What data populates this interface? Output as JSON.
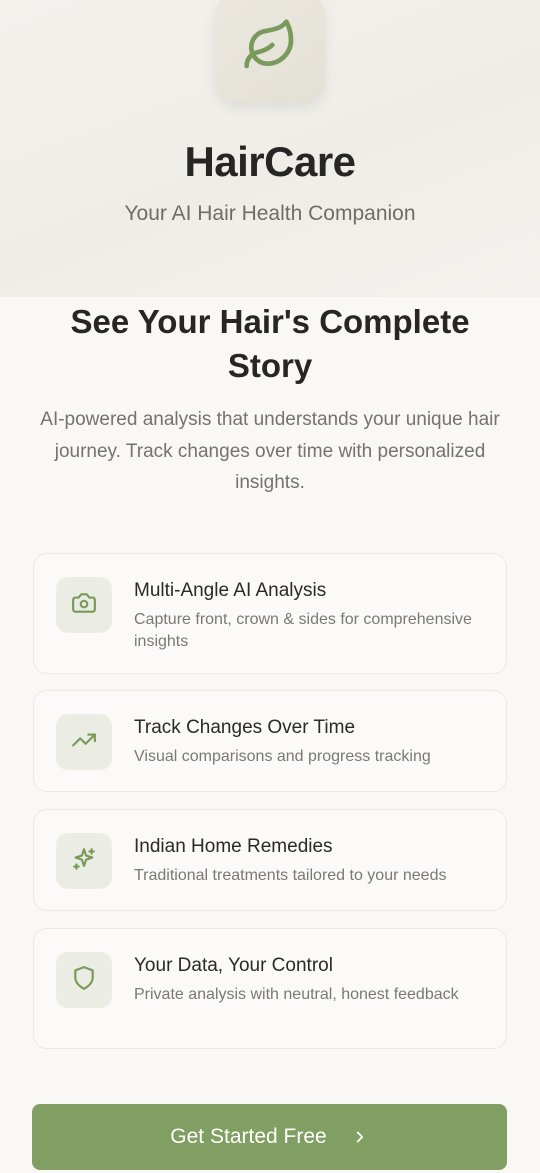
{
  "app": {
    "title": "HairCare",
    "subtitle": "Your AI Hair Health Companion",
    "logo_icon": "leaf-icon"
  },
  "intro": {
    "headline": "See Your Hair's Complete Story",
    "description": "AI-powered analysis that understands your unique hair journey. Track changes over time with personalized insights."
  },
  "features": [
    {
      "icon": "camera-icon",
      "title": "Multi-Angle AI Analysis",
      "description": "Capture front, crown & sides for comprehensive insights"
    },
    {
      "icon": "trending-up-icon",
      "title": "Track Changes Over Time",
      "description": "Visual comparisons and progress tracking"
    },
    {
      "icon": "sparkles-icon",
      "title": "Indian Home Remedies",
      "description": "Traditional treatments tailored to your needs"
    },
    {
      "icon": "shield-icon",
      "title": "Your Data, Your Control",
      "description": "Private analysis with neutral, honest feedback"
    }
  ],
  "cta": {
    "label": "Get Started Free",
    "icon": "chevron-right-icon"
  },
  "colors": {
    "accent": "#819f63",
    "icon_tint": "#7a9a5c",
    "background": "#f9f8f5"
  }
}
